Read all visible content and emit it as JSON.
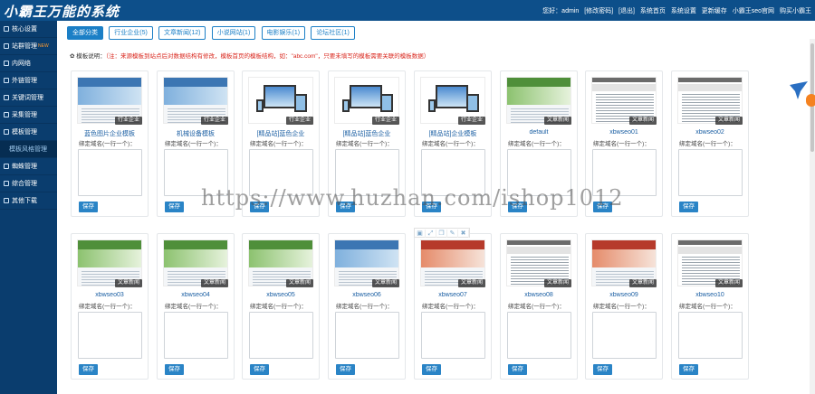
{
  "header": {
    "logo": "小霸王万能的系统",
    "links": [
      "您好：admin",
      "[修改密码]",
      "[退出]",
      "系统首页",
      "系统设置",
      "更新缓存",
      "小霸王seo官网",
      "购买小霸王"
    ]
  },
  "sidebar": {
    "items": [
      {
        "label": "核心设置",
        "new": ""
      },
      {
        "label": "站群管理",
        "new": "NEW"
      },
      {
        "label": "内网络",
        "new": ""
      },
      {
        "label": "外链管理",
        "new": ""
      },
      {
        "label": "关键词管理",
        "new": ""
      },
      {
        "label": "采集管理",
        "new": ""
      },
      {
        "label": "模板管理",
        "new": ""
      },
      {
        "label": "模板风格管理",
        "new": "",
        "sub": true
      },
      {
        "label": "蜘蛛管理",
        "new": ""
      },
      {
        "label": "综合管理",
        "new": ""
      },
      {
        "label": "其他下载",
        "new": ""
      }
    ]
  },
  "filters": [
    "全部分类",
    "行业企业(5)",
    "文章新闻(12)",
    "小说网站(1)",
    "电影娱乐(1)",
    "论坛社区(1)"
  ],
  "note": {
    "prefix": "模板说明：",
    "text": "（注：来源模板到站点后对数据结构有修改，模板首页的模板结构，如：\"abc.com\"，只要未填写的模板需要关联的模板数据）"
  },
  "card_common": {
    "bind_label": "绑定域名(一行一个)：",
    "save": "保存"
  },
  "cards": [
    {
      "title": "蓝色图片企业模板",
      "badge": "行业企业",
      "style": "blue"
    },
    {
      "title": "机械设备模板",
      "badge": "行业企业",
      "style": "blue"
    },
    {
      "title": "[精品站]蓝色企业",
      "badge": "行业企业",
      "style": "devices"
    },
    {
      "title": "[精品站]蓝色企业",
      "badge": "行业企业",
      "style": "devices"
    },
    {
      "title": "[精品站]企业模板",
      "badge": "行业企业",
      "style": "devices"
    },
    {
      "title": "default",
      "badge": "文章新闻",
      "style": "green"
    },
    {
      "title": "xbwseo01",
      "badge": "文章新闻",
      "style": "doc"
    },
    {
      "title": "xbwseo02",
      "badge": "文章新闻",
      "style": "doc"
    },
    {
      "title": "xbwseo03",
      "badge": "文章新闻",
      "style": "green"
    },
    {
      "title": "xbwseo04",
      "badge": "文章新闻",
      "style": "green"
    },
    {
      "title": "xbwseo05",
      "badge": "文章新闻",
      "style": "green"
    },
    {
      "title": "xbwseo06",
      "badge": "文章新闻",
      "style": "blue"
    },
    {
      "title": "xbwseo07",
      "badge": "文章新闻",
      "style": "red"
    },
    {
      "title": "xbwseo08",
      "badge": "文章新闻",
      "style": "doc"
    },
    {
      "title": "xbwseo09",
      "badge": "文章新闻",
      "style": "red"
    },
    {
      "title": "xbwseo10",
      "badge": "文章新闻",
      "style": "doc"
    }
  ],
  "watermark": "https://www.huzhan.com/ishop1012",
  "float_tools": [
    "save-icon",
    "expand-icon",
    "copy-icon",
    "edit-icon",
    "delete-icon"
  ],
  "colors": {
    "header": "#0d4f8a",
    "sidebar": "#0a3d6e",
    "accent": "#1b7fc6",
    "button": "#2a84c6"
  }
}
